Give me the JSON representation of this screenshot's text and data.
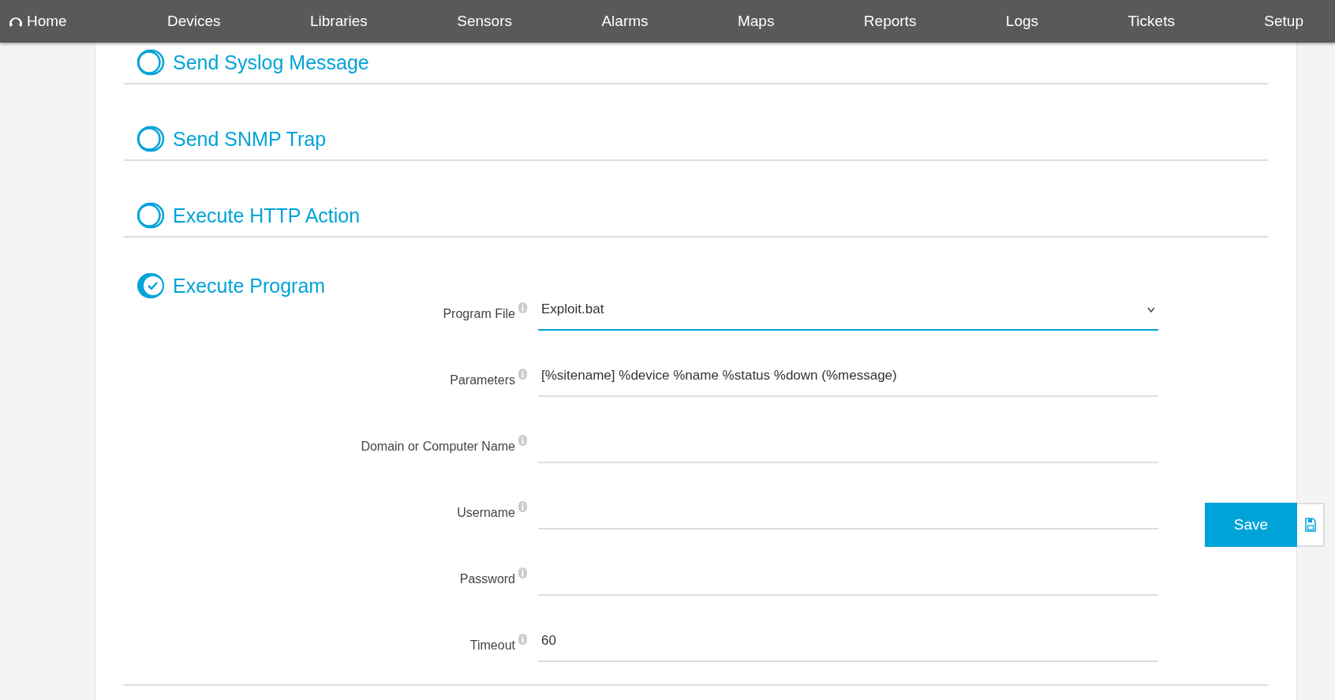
{
  "nav": {
    "home": "Home",
    "items": [
      "Devices",
      "Libraries",
      "Sensors",
      "Alarms",
      "Maps",
      "Reports",
      "Logs",
      "Tickets",
      "Setup"
    ]
  },
  "sections": [
    {
      "title": "Send Syslog Message",
      "on": false
    },
    {
      "title": "Send SNMP Trap",
      "on": false
    },
    {
      "title": "Execute HTTP Action",
      "on": false
    },
    {
      "title": "Execute Program",
      "on": true,
      "fields": [
        {
          "label": "Program File",
          "kind": "select",
          "value": "Exploit.bat"
        },
        {
          "label": "Parameters",
          "kind": "text",
          "value": "[%sitename] %device %name %status %down (%message)"
        },
        {
          "label": "Domain or Computer Name",
          "kind": "text"
        },
        {
          "label": "Username",
          "kind": "text"
        },
        {
          "label": "Password",
          "kind": "password"
        },
        {
          "label": "Timeout",
          "kind": "text",
          "value": "60"
        }
      ]
    }
  ],
  "save": {
    "label": "Save"
  }
}
